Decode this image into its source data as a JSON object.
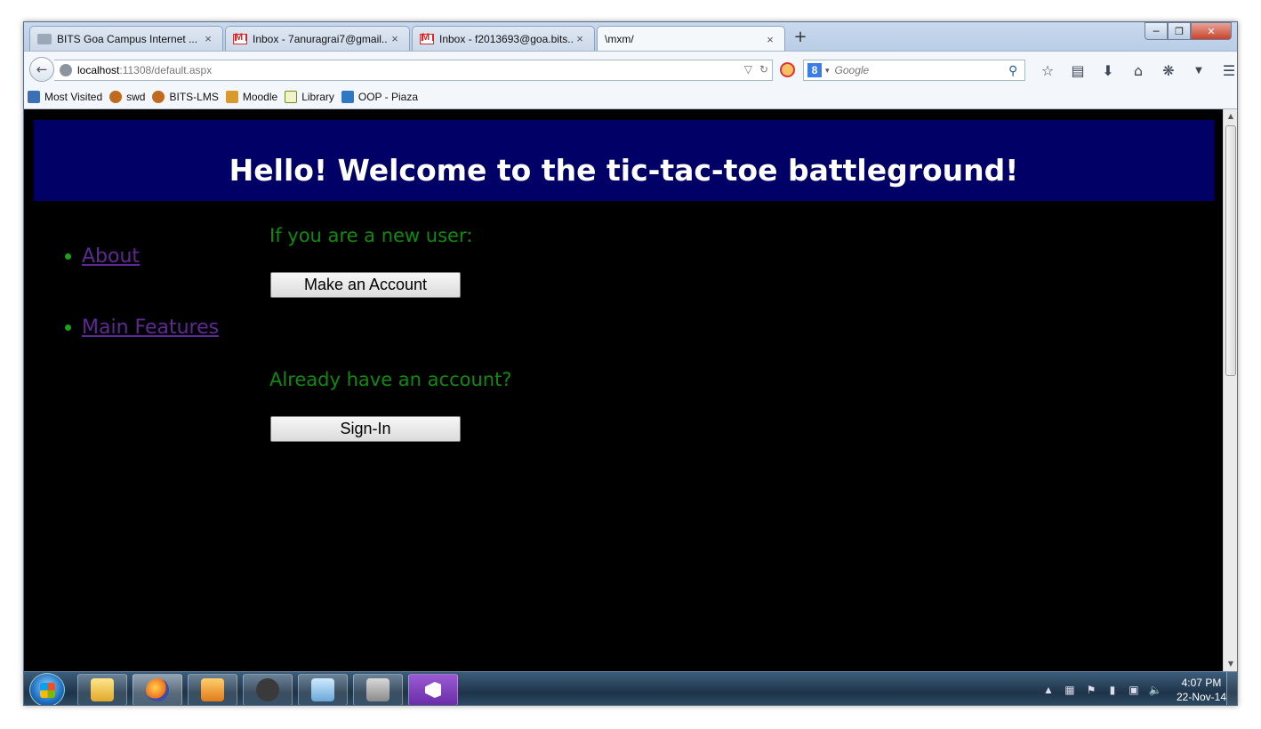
{
  "browser": {
    "tabs": [
      {
        "label": "BITS Goa Campus Internet ...",
        "icon": "generic-page-icon"
      },
      {
        "label": "Inbox - 7anuragrai7@gmail...",
        "icon": "gmail-icon"
      },
      {
        "label": "Inbox - f2013693@goa.bits...",
        "icon": "gmail-icon"
      },
      {
        "label": "\\mxm/",
        "icon": "none"
      }
    ],
    "tab_close_glyph": "×",
    "new_tab_glyph": "+",
    "url_host": "localhost",
    "url_rest": ":11308/default.aspx",
    "search_engine": "8",
    "search_placeholder": "Google",
    "bookmarks": [
      {
        "label": "Most Visited",
        "color": "#3b6fb6"
      },
      {
        "label": "swd",
        "color": "#c06a20"
      },
      {
        "label": "BITS-LMS",
        "color": "#c06a20"
      },
      {
        "label": "Moodle",
        "color": "#d99a2b"
      },
      {
        "label": "Library",
        "color": "#6b8e23"
      },
      {
        "label": "OOP - Piaza",
        "color": "#2f78c4"
      }
    ]
  },
  "page": {
    "banner_title": "Hello! Welcome to the tic-tac-toe battleground!",
    "banner_color": "#000066",
    "nav_links": [
      {
        "label": "About"
      },
      {
        "label": "Main Features"
      }
    ],
    "new_user_prompt": "If you are a new user:",
    "make_account_label": "Make an Account",
    "existing_user_prompt": "Already have an account?",
    "sign_in_label": "Sign-In",
    "label_color": "#0f8a0f",
    "link_color": "#5d2a94"
  },
  "taskbar": {
    "apps": [
      "file-explorer",
      "firefox",
      "media-player",
      "inkscape",
      "notepad",
      "settings-tool",
      "visual-studio"
    ],
    "time": "4:07 PM",
    "date": "22-Nov-14"
  }
}
